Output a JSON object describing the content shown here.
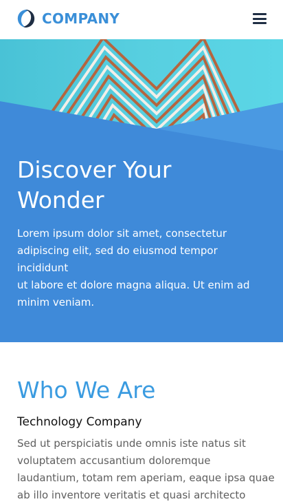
{
  "header": {
    "logo_text": "COMPANY",
    "logo_icon": "swoosh-logo-icon",
    "menu_icon": "hamburger-menu-icon"
  },
  "hero": {
    "title": "Discover Your\nWonder",
    "text": "Lorem ipsum dolor sit amet, consectetur\nadipiscing elit, sed do eiusmod tempor incididunt\nut labore et dolore magna aliqua. Ut enim ad\nminim veniam."
  },
  "about": {
    "heading": "Who We Are",
    "subheading": "Technology Company",
    "text": "Sed ut perspiciatis unde omnis iste natus sit\nvoluptatem accusantium doloremque\nlaudantium, totam rem aperiam, eaque ipsa quae\nab illo inventore veritatis et quasi architecto"
  },
  "colors": {
    "brand_blue": "#3a8fd8",
    "hero_blue": "#3f8ad9",
    "heading_blue": "#3a9be0",
    "sky_cyan": "#5bd3e4",
    "building_copper": "#b5653f",
    "menu_dark": "#1f2e44"
  }
}
